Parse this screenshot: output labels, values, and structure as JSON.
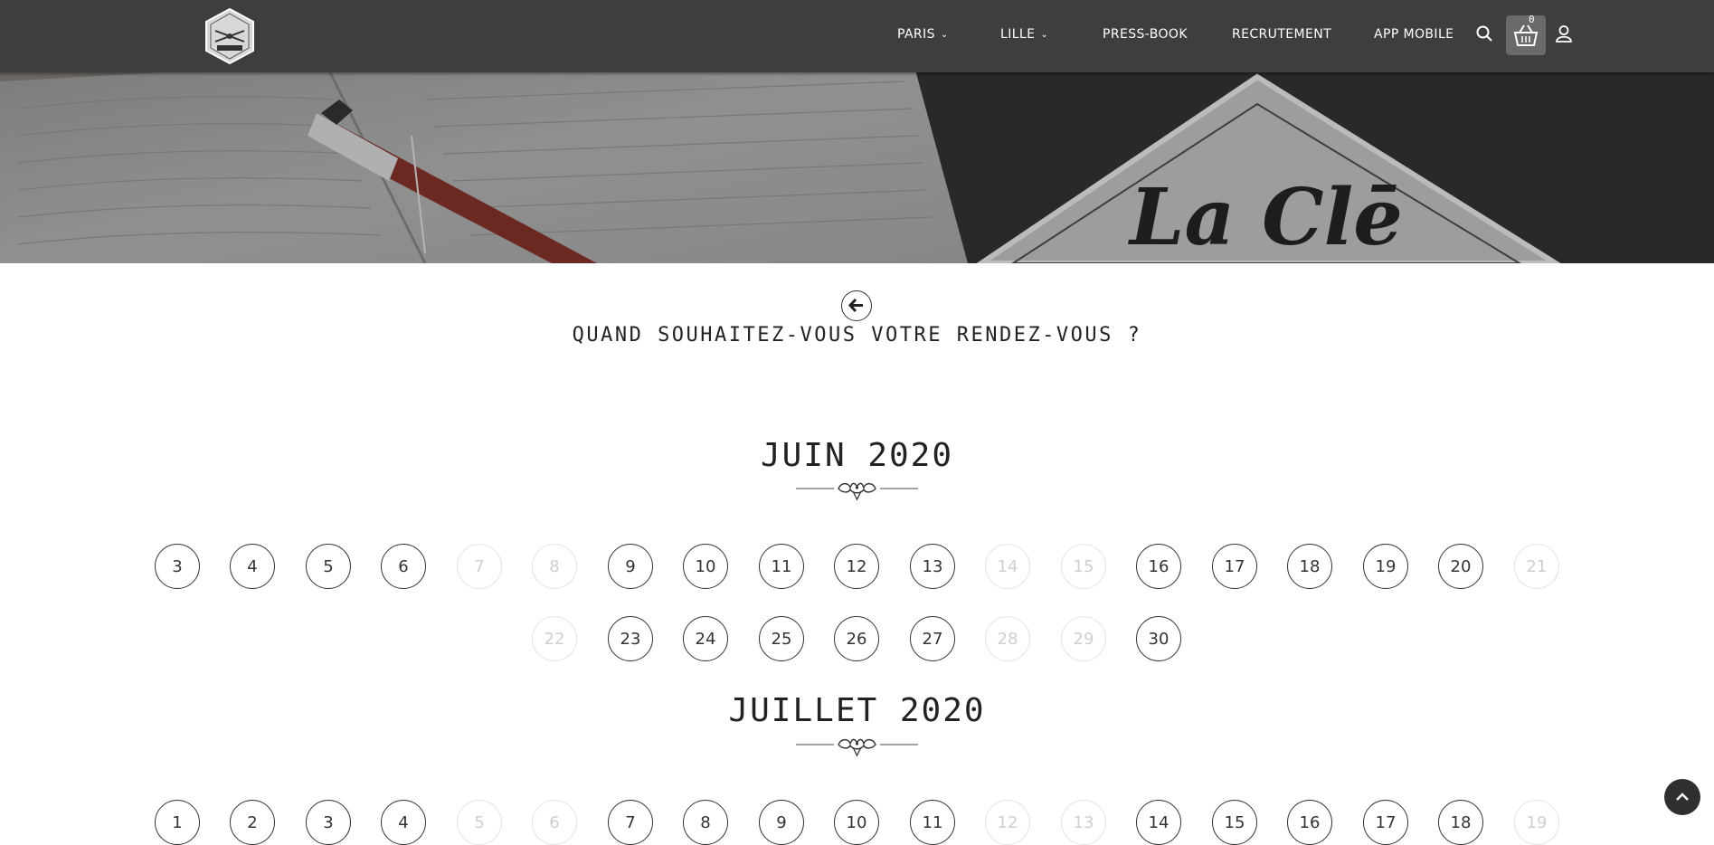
{
  "header": {
    "logo_icon": "barber-logo-icon",
    "nav": [
      {
        "label": "PARIS",
        "dropdown": true
      },
      {
        "label": "LILLE",
        "dropdown": true
      },
      {
        "label": "PRESS-BOOK",
        "dropdown": false
      },
      {
        "label": "RECRUTEMENT",
        "dropdown": false
      },
      {
        "label": "APP MOBILE",
        "dropdown": false
      }
    ],
    "cart_count": "0",
    "icons": [
      "search-icon",
      "basket-icon",
      "user-icon"
    ]
  },
  "hero": {
    "sign_text": "La Clē"
  },
  "question": "QUAND SOUHAITEZ-VOUS VOTRE RENDEZ-VOUS ?",
  "months": [
    {
      "title": "JUIN 2020",
      "rows": [
        [
          {
            "day": "3",
            "available": true
          },
          {
            "day": "4",
            "available": true
          },
          {
            "day": "5",
            "available": true
          },
          {
            "day": "6",
            "available": true
          },
          {
            "day": "7",
            "available": false
          },
          {
            "day": "8",
            "available": false
          },
          {
            "day": "9",
            "available": true
          },
          {
            "day": "10",
            "available": true
          },
          {
            "day": "11",
            "available": true
          },
          {
            "day": "12",
            "available": true
          },
          {
            "day": "13",
            "available": true
          },
          {
            "day": "14",
            "available": false
          },
          {
            "day": "15",
            "available": false
          },
          {
            "day": "16",
            "available": true
          },
          {
            "day": "17",
            "available": true
          },
          {
            "day": "18",
            "available": true
          },
          {
            "day": "19",
            "available": true
          },
          {
            "day": "20",
            "available": true
          },
          {
            "day": "21",
            "available": false
          }
        ],
        [
          {
            "day": "22",
            "available": false
          },
          {
            "day": "23",
            "available": true
          },
          {
            "day": "24",
            "available": true
          },
          {
            "day": "25",
            "available": true
          },
          {
            "day": "26",
            "available": true
          },
          {
            "day": "27",
            "available": true
          },
          {
            "day": "28",
            "available": false
          },
          {
            "day": "29",
            "available": false
          },
          {
            "day": "30",
            "available": true
          }
        ]
      ]
    },
    {
      "title": "JUILLET 2020",
      "rows": [
        [
          {
            "day": "1",
            "available": true
          },
          {
            "day": "2",
            "available": true
          },
          {
            "day": "3",
            "available": true
          },
          {
            "day": "4",
            "available": true
          },
          {
            "day": "5",
            "available": false
          },
          {
            "day": "6",
            "available": false
          },
          {
            "day": "7",
            "available": true
          },
          {
            "day": "8",
            "available": true
          },
          {
            "day": "9",
            "available": true
          },
          {
            "day": "10",
            "available": true
          },
          {
            "day": "11",
            "available": true
          },
          {
            "day": "12",
            "available": false
          },
          {
            "day": "13",
            "available": false
          },
          {
            "day": "14",
            "available": true
          },
          {
            "day": "15",
            "available": true
          },
          {
            "day": "16",
            "available": true
          },
          {
            "day": "17",
            "available": true
          },
          {
            "day": "18",
            "available": true
          },
          {
            "day": "19",
            "available": false
          }
        ]
      ]
    }
  ]
}
